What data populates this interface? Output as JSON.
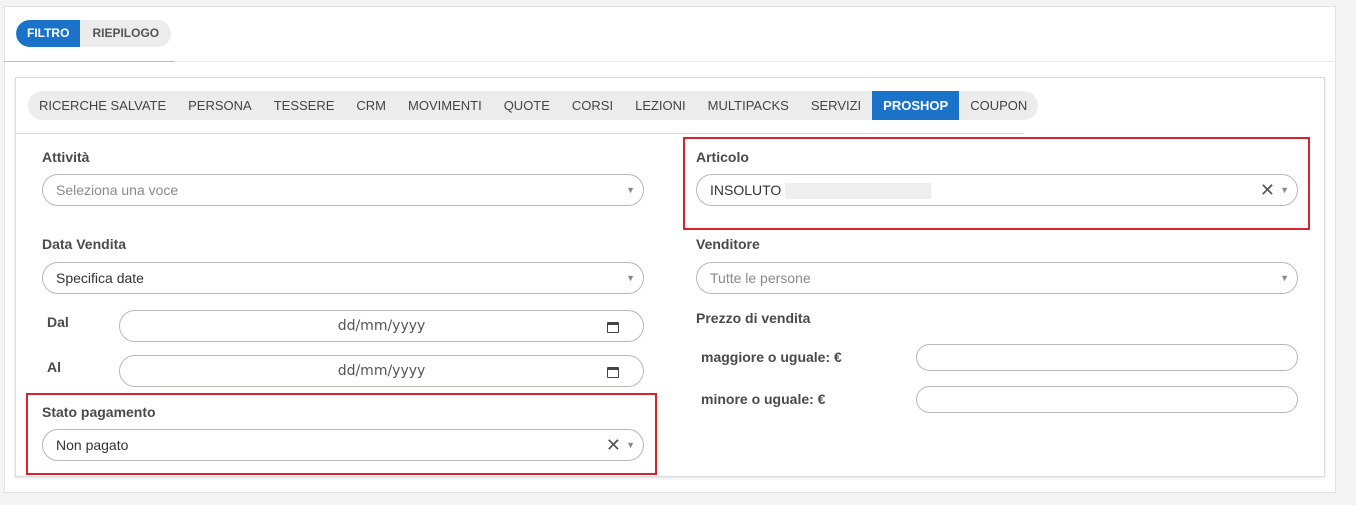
{
  "main_tabs": [
    {
      "label": "FILTRO",
      "active": true
    },
    {
      "label": "RIEPILOGO",
      "active": false
    }
  ],
  "sub_tabs": [
    {
      "label": "RICERCHE SALVATE"
    },
    {
      "label": "PERSONA"
    },
    {
      "label": "TESSERE"
    },
    {
      "label": "CRM"
    },
    {
      "label": "MOVIMENTI"
    },
    {
      "label": "QUOTE"
    },
    {
      "label": "CORSI"
    },
    {
      "label": "LEZIONI"
    },
    {
      "label": "MULTIPACKS"
    },
    {
      "label": "SERVIZI"
    },
    {
      "label": "PROSHOP",
      "active": true
    },
    {
      "label": "COUPON"
    }
  ],
  "left": {
    "attivita": {
      "label": "Attività",
      "placeholder": "Seleziona una voce"
    },
    "data_vendita": {
      "label": "Data Vendita",
      "value": "Specifica date"
    },
    "dal": {
      "label": "Dal",
      "placeholder": "dd/mm/yyyy"
    },
    "al": {
      "label": "Al",
      "placeholder": "dd/mm/yyyy"
    },
    "stato_pagamento": {
      "label": "Stato pagamento",
      "value": "Non pagato"
    }
  },
  "right": {
    "articolo": {
      "label": "Articolo",
      "value": "INSOLUTO"
    },
    "venditore": {
      "label": "Venditore",
      "placeholder": "Tutte le persone"
    },
    "prezzo": {
      "label": "Prezzo di vendita",
      "min_label": "maggiore o uguale: €",
      "max_label": "minore o uguale: €"
    }
  },
  "icons": {
    "clear": "✕",
    "dropdown": "▼"
  },
  "colors": {
    "accent": "#1a73c9",
    "highlight": "#d8232a"
  }
}
